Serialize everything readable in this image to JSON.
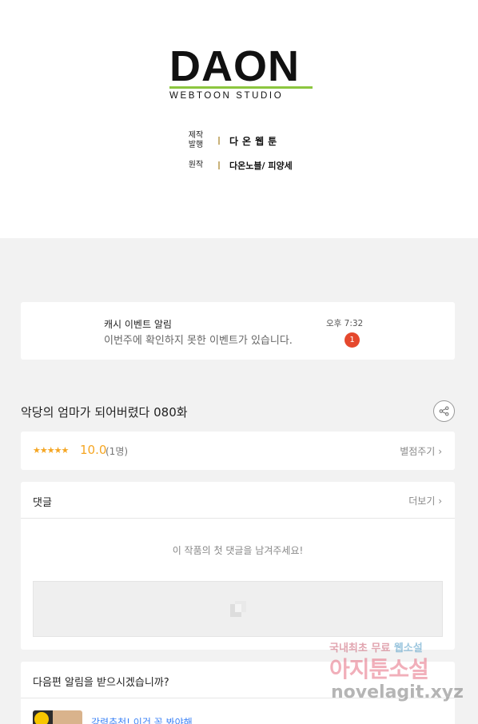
{
  "credits": {
    "logo_main": "DAON",
    "logo_sub": "WEBTOON STUDIO",
    "rows": [
      {
        "label_line1": "제작",
        "label_line2": "발행",
        "value": "다온웹툰"
      },
      {
        "label_line1": "원작",
        "value": "다온노블/ 피양세"
      }
    ]
  },
  "notification": {
    "title": "캐시 이벤트 알림",
    "message": "이번주에 확인하지 못한 이벤트가 있습니다.",
    "time": "오후 7:32",
    "badge": "1"
  },
  "episode": {
    "title": "악당의 엄마가 되어버렸다 080화"
  },
  "rating": {
    "stars": "★★★★★",
    "score": "10.0",
    "count": "(1명)",
    "rate_link": "별점주기"
  },
  "comments": {
    "title": "댓글",
    "more": "더보기",
    "empty_message": "이 작품의 첫 댓글을 남겨주세요!"
  },
  "next_episode": {
    "title": "다음편 알림을 받으시겠습니까?",
    "promo_text": "강력추천! 이건 꼭 봐야해"
  },
  "watermark": {
    "line1_a": "국내최초 무료 ",
    "line1_b": "웹소설",
    "line2": "아지툰소설",
    "line3": "novelagit.xyz"
  },
  "colors": {
    "accent_orange": "#f5a623",
    "badge_red": "#e5482d",
    "logo_green": "#8cc63f",
    "link_blue": "#3b82f6"
  }
}
